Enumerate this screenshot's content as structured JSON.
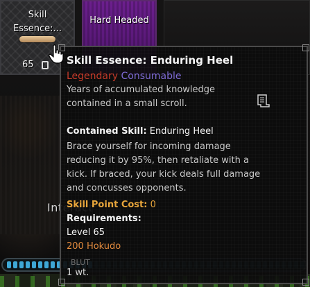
{
  "inventory": {
    "essence_slot": {
      "name": "Skill\nEssence:...",
      "level": "65"
    },
    "hard_slot": {
      "name": "Hard Headed"
    }
  },
  "world": {
    "interact_label": "Interact"
  },
  "tooltip": {
    "title": "Skill Essence: Enduring Heel",
    "rarity": "Legendary",
    "category": "Consumable",
    "lore": "Years of accumulated knowledge\ncontained in a small scroll.",
    "contained_skill_label": "Contained Skill:",
    "contained_skill_value": " Enduring Heel",
    "description": "Brace yourself for incoming damage\nreducing it by 95%, then retaliate with a\nkick. If braced, your kick deals full damage\nand concusses opponents.",
    "skill_point_cost_label": "Skill Point Cost:",
    "skill_point_cost_value": " 0",
    "requirements_label": "Requirements:",
    "req_level": "Level 65",
    "req_hokudo": "200 Hokudo",
    "faded_label": "BLUT",
    "weight": "1 wt."
  },
  "colors": {
    "legendary": "#c53a2a",
    "consumable": "#7f6bd6",
    "cost": "#e7a53b",
    "hokudo": "#e28a3d",
    "hotbar": "#3ea7d6"
  },
  "icons": [
    "hand-cursor-icon",
    "lock-icon",
    "scroll-icon"
  ],
  "hotbar": {
    "fill_fraction": 0.3
  }
}
